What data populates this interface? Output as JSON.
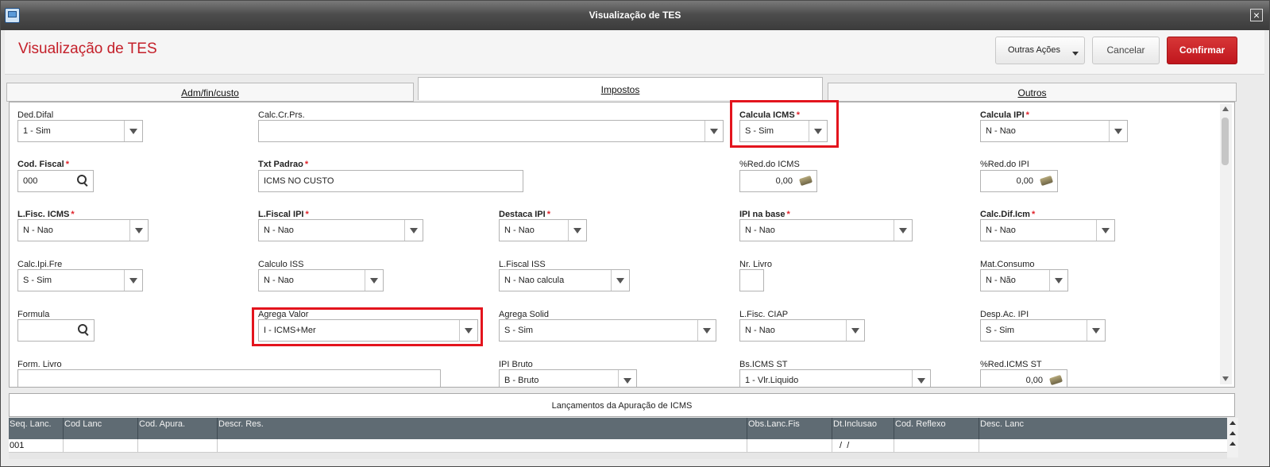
{
  "window": {
    "title": "Visualização de TES",
    "close_label": "×"
  },
  "header": {
    "title": "Visualização de TES",
    "outras_label": "Outras Ações",
    "cancel_label": "Cancelar",
    "confirm_label": "Confirmar"
  },
  "tabs": [
    {
      "label": "Adm/fin/custo"
    },
    {
      "label": "Impostos"
    },
    {
      "label": "Outros"
    }
  ],
  "fields": {
    "ded_difal": {
      "label": "Ded.Difal",
      "value": "1 - Sim"
    },
    "calc_cr_prs": {
      "label": "Calc.Cr.Prs.",
      "value": ""
    },
    "calcula_icms": {
      "label": "Calcula ICMS",
      "req": "*",
      "value": "S - Sim"
    },
    "calcula_ipi": {
      "label": "Calcula IPI",
      "req": "*",
      "value": "N - Nao"
    },
    "cod_fiscal": {
      "label": "Cod. Fiscal",
      "req": "*",
      "value": "000"
    },
    "txt_padrao": {
      "label": "Txt Padrao",
      "req": "*",
      "value": "ICMS NO CUSTO"
    },
    "red_icms": {
      "label": "%Red.do ICMS",
      "value": "0,00"
    },
    "red_ipi": {
      "label": "%Red.do IPI",
      "value": "0,00"
    },
    "lfisc_icms": {
      "label": "L.Fisc. ICMS",
      "req": "*",
      "value": "N - Nao"
    },
    "lfiscal_ipi": {
      "label": "L.Fiscal IPI",
      "req": "*",
      "value": "N - Nao"
    },
    "destaca_ipi": {
      "label": "Destaca IPI",
      "req": "*",
      "value": "N - Nao"
    },
    "ipi_na_base": {
      "label": "IPI na base",
      "req": "*",
      "value": "N - Nao"
    },
    "calc_dif_icm": {
      "label": "Calc.Dif.Icm",
      "req": "*",
      "value": "N - Nao"
    },
    "calc_ipi_fre": {
      "label": "Calc.Ipi.Fre",
      "value": "S - Sim"
    },
    "calculo_iss": {
      "label": "Calculo ISS",
      "value": "N - Nao"
    },
    "lfiscal_iss": {
      "label": "L.Fiscal ISS",
      "value": "N - Nao calcula"
    },
    "nr_livro": {
      "label": "Nr. Livro",
      "value": ""
    },
    "mat_consumo": {
      "label": "Mat.Consumo",
      "value": "N - Não"
    },
    "formula": {
      "label": "Formula",
      "value": ""
    },
    "agrega_valor": {
      "label": "Agrega Valor",
      "value": "I - ICMS+Mer"
    },
    "agrega_solid": {
      "label": "Agrega Solid",
      "value": "S - Sim"
    },
    "lfisc_ciap": {
      "label": "L.Fisc. CIAP",
      "value": "N - Nao"
    },
    "desp_ac_ipi": {
      "label": "Desp.Ac. IPI",
      "value": "S - Sim"
    },
    "form_livro": {
      "label": "Form. Livro",
      "value": ""
    },
    "ipi_bruto": {
      "label": "IPI Bruto",
      "value": "B - Bruto"
    },
    "bs_icms_st": {
      "label": "Bs.ICMS ST",
      "value": "1 - Vlr.Liquido"
    },
    "red_icms_st": {
      "label": "%Red.ICMS ST",
      "value": "0,00"
    }
  },
  "grid": {
    "title": "Lançamentos da Apuração de ICMS",
    "columns": [
      "Seq. Lanc.",
      "Cod Lanc",
      "Cod. Apura.",
      "Descr. Res.",
      "Obs.Lanc.Fis",
      "Dt.Inclusao",
      "Cod. Reflexo",
      "Desc. Lanc"
    ],
    "row": [
      "001",
      "",
      "",
      "",
      "",
      " /  / ",
      "",
      ""
    ]
  },
  "colors": {
    "accent": "#c4202a",
    "highlight": "#e3141d",
    "grid_header": "#5f6b73"
  }
}
